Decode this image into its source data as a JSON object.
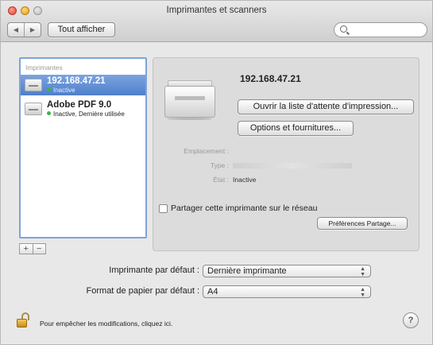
{
  "window": {
    "title": "Imprimantes et scanners",
    "back_icon": "◀",
    "forward_icon": "▶",
    "show_all_label": "Tout afficher",
    "search_placeholder": ""
  },
  "printers": {
    "header": "Imprimantes",
    "items": [
      {
        "name": "192.168.47.21",
        "status": "Inactive",
        "selected": true,
        "status_color": "#3cb34a"
      },
      {
        "name": "Adobe PDF 9.0",
        "status": "Inactive, Dernière utilisée",
        "selected": false,
        "status_color": "#3cb34a"
      }
    ],
    "add_label": "+",
    "remove_label": "−"
  },
  "details": {
    "printer_name": "192.168.47.21",
    "queue_button": "Ouvrir la liste d'attente d'impression...",
    "options_button": "Options et fournitures...",
    "location_label": "Emplacement :",
    "location_value": "",
    "type_label": "Type :",
    "type_value": "",
    "state_label": "État :",
    "state_value": "Inactive",
    "share_label": "Partager cette imprimante sur le réseau",
    "share_checked": false,
    "share_prefs_button": "Préférences Partage..."
  },
  "defaults": {
    "default_printer_label": "Imprimante par défaut :",
    "default_printer_value": "Dernière imprimante",
    "paper_format_label": "Format de papier par défaut :",
    "paper_format_value": "A4"
  },
  "footer": {
    "lock_text": "Pour empêcher les modifications, cliquez ici.",
    "help_label": "?"
  },
  "colors": {
    "selection": "#5b8ad4",
    "status_green": "#3cb34a",
    "list_focus_ring": "#7fa3d8"
  }
}
